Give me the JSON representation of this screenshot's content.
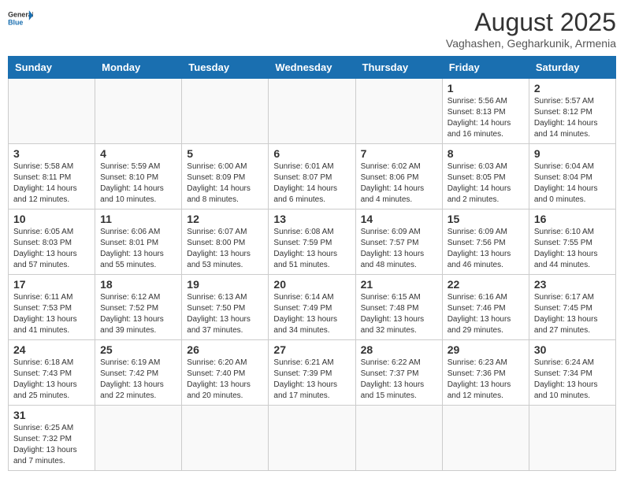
{
  "header": {
    "logo_general": "General",
    "logo_blue": "Blue",
    "month_title": "August 2025",
    "location": "Vaghashen, Gegharkunik, Armenia"
  },
  "days_of_week": [
    "Sunday",
    "Monday",
    "Tuesday",
    "Wednesday",
    "Thursday",
    "Friday",
    "Saturday"
  ],
  "weeks": [
    [
      {
        "day": "",
        "info": ""
      },
      {
        "day": "",
        "info": ""
      },
      {
        "day": "",
        "info": ""
      },
      {
        "day": "",
        "info": ""
      },
      {
        "day": "",
        "info": ""
      },
      {
        "day": "1",
        "info": "Sunrise: 5:56 AM\nSunset: 8:13 PM\nDaylight: 14 hours and 16 minutes."
      },
      {
        "day": "2",
        "info": "Sunrise: 5:57 AM\nSunset: 8:12 PM\nDaylight: 14 hours and 14 minutes."
      }
    ],
    [
      {
        "day": "3",
        "info": "Sunrise: 5:58 AM\nSunset: 8:11 PM\nDaylight: 14 hours and 12 minutes."
      },
      {
        "day": "4",
        "info": "Sunrise: 5:59 AM\nSunset: 8:10 PM\nDaylight: 14 hours and 10 minutes."
      },
      {
        "day": "5",
        "info": "Sunrise: 6:00 AM\nSunset: 8:09 PM\nDaylight: 14 hours and 8 minutes."
      },
      {
        "day": "6",
        "info": "Sunrise: 6:01 AM\nSunset: 8:07 PM\nDaylight: 14 hours and 6 minutes."
      },
      {
        "day": "7",
        "info": "Sunrise: 6:02 AM\nSunset: 8:06 PM\nDaylight: 14 hours and 4 minutes."
      },
      {
        "day": "8",
        "info": "Sunrise: 6:03 AM\nSunset: 8:05 PM\nDaylight: 14 hours and 2 minutes."
      },
      {
        "day": "9",
        "info": "Sunrise: 6:04 AM\nSunset: 8:04 PM\nDaylight: 14 hours and 0 minutes."
      }
    ],
    [
      {
        "day": "10",
        "info": "Sunrise: 6:05 AM\nSunset: 8:03 PM\nDaylight: 13 hours and 57 minutes."
      },
      {
        "day": "11",
        "info": "Sunrise: 6:06 AM\nSunset: 8:01 PM\nDaylight: 13 hours and 55 minutes."
      },
      {
        "day": "12",
        "info": "Sunrise: 6:07 AM\nSunset: 8:00 PM\nDaylight: 13 hours and 53 minutes."
      },
      {
        "day": "13",
        "info": "Sunrise: 6:08 AM\nSunset: 7:59 PM\nDaylight: 13 hours and 51 minutes."
      },
      {
        "day": "14",
        "info": "Sunrise: 6:09 AM\nSunset: 7:57 PM\nDaylight: 13 hours and 48 minutes."
      },
      {
        "day": "15",
        "info": "Sunrise: 6:09 AM\nSunset: 7:56 PM\nDaylight: 13 hours and 46 minutes."
      },
      {
        "day": "16",
        "info": "Sunrise: 6:10 AM\nSunset: 7:55 PM\nDaylight: 13 hours and 44 minutes."
      }
    ],
    [
      {
        "day": "17",
        "info": "Sunrise: 6:11 AM\nSunset: 7:53 PM\nDaylight: 13 hours and 41 minutes."
      },
      {
        "day": "18",
        "info": "Sunrise: 6:12 AM\nSunset: 7:52 PM\nDaylight: 13 hours and 39 minutes."
      },
      {
        "day": "19",
        "info": "Sunrise: 6:13 AM\nSunset: 7:50 PM\nDaylight: 13 hours and 37 minutes."
      },
      {
        "day": "20",
        "info": "Sunrise: 6:14 AM\nSunset: 7:49 PM\nDaylight: 13 hours and 34 minutes."
      },
      {
        "day": "21",
        "info": "Sunrise: 6:15 AM\nSunset: 7:48 PM\nDaylight: 13 hours and 32 minutes."
      },
      {
        "day": "22",
        "info": "Sunrise: 6:16 AM\nSunset: 7:46 PM\nDaylight: 13 hours and 29 minutes."
      },
      {
        "day": "23",
        "info": "Sunrise: 6:17 AM\nSunset: 7:45 PM\nDaylight: 13 hours and 27 minutes."
      }
    ],
    [
      {
        "day": "24",
        "info": "Sunrise: 6:18 AM\nSunset: 7:43 PM\nDaylight: 13 hours and 25 minutes."
      },
      {
        "day": "25",
        "info": "Sunrise: 6:19 AM\nSunset: 7:42 PM\nDaylight: 13 hours and 22 minutes."
      },
      {
        "day": "26",
        "info": "Sunrise: 6:20 AM\nSunset: 7:40 PM\nDaylight: 13 hours and 20 minutes."
      },
      {
        "day": "27",
        "info": "Sunrise: 6:21 AM\nSunset: 7:39 PM\nDaylight: 13 hours and 17 minutes."
      },
      {
        "day": "28",
        "info": "Sunrise: 6:22 AM\nSunset: 7:37 PM\nDaylight: 13 hours and 15 minutes."
      },
      {
        "day": "29",
        "info": "Sunrise: 6:23 AM\nSunset: 7:36 PM\nDaylight: 13 hours and 12 minutes."
      },
      {
        "day": "30",
        "info": "Sunrise: 6:24 AM\nSunset: 7:34 PM\nDaylight: 13 hours and 10 minutes."
      }
    ],
    [
      {
        "day": "31",
        "info": "Sunrise: 6:25 AM\nSunset: 7:32 PM\nDaylight: 13 hours and 7 minutes."
      },
      {
        "day": "",
        "info": ""
      },
      {
        "day": "",
        "info": ""
      },
      {
        "day": "",
        "info": ""
      },
      {
        "day": "",
        "info": ""
      },
      {
        "day": "",
        "info": ""
      },
      {
        "day": "",
        "info": ""
      }
    ]
  ]
}
